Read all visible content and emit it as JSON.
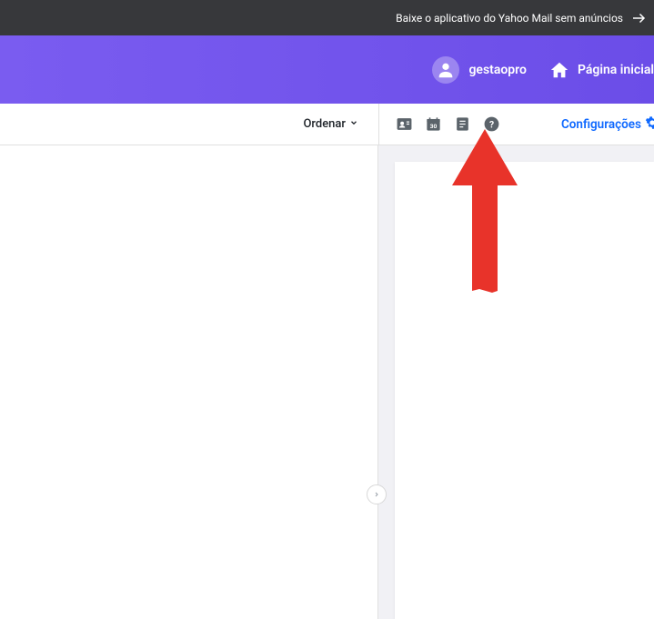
{
  "banner": {
    "text": "Baixe o aplicativo do Yahoo Mail sem anúncios"
  },
  "header": {
    "username": "gestaopro",
    "home_label": "Página inicial"
  },
  "toolbar": {
    "sort_label": "Ordenar",
    "config_label": "Configurações",
    "calendar_day": "30"
  }
}
